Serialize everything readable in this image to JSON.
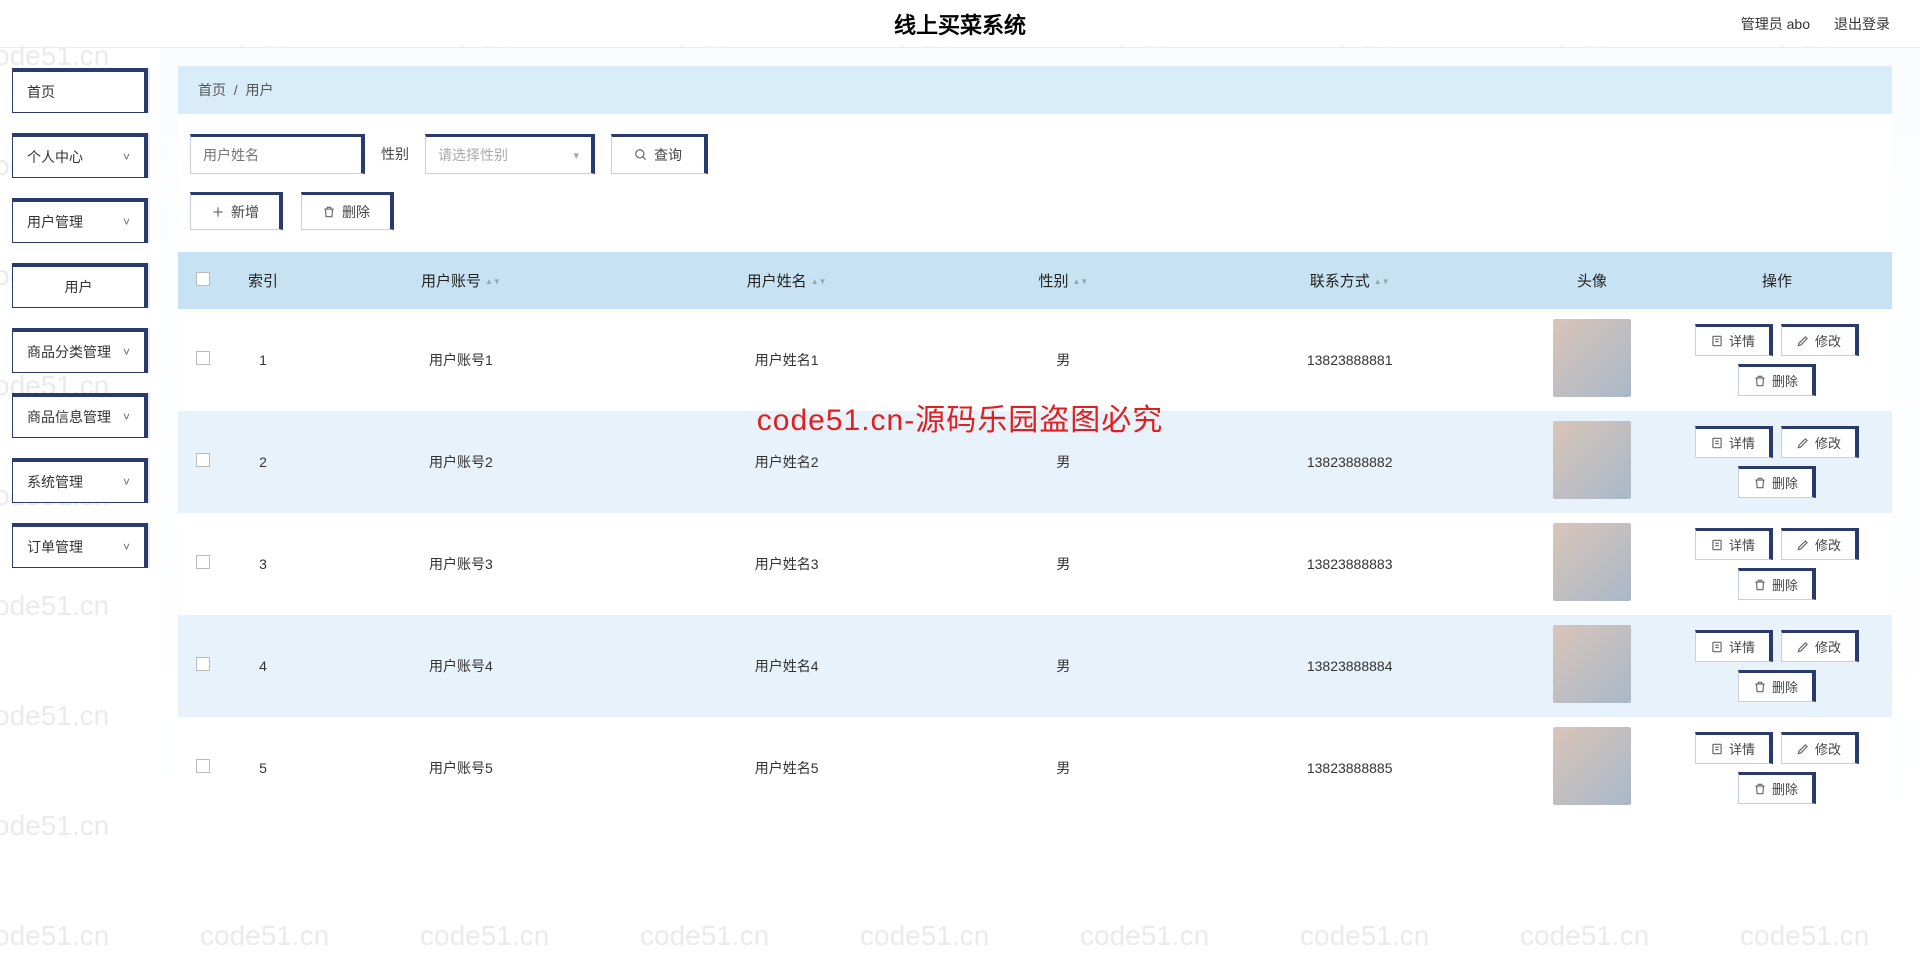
{
  "header": {
    "title": "线上买菜系统",
    "admin_label": "管理员 abo",
    "logout_label": "退出登录"
  },
  "sidebar": [
    {
      "label": "首页",
      "expandable": false
    },
    {
      "label": "个人中心",
      "expandable": true
    },
    {
      "label": "用户管理",
      "expandable": true
    },
    {
      "label": "用户",
      "expandable": false,
      "leaf": true
    },
    {
      "label": "商品分类管理",
      "expandable": true
    },
    {
      "label": "商品信息管理",
      "expandable": true
    },
    {
      "label": "系统管理",
      "expandable": true
    },
    {
      "label": "订单管理",
      "expandable": true
    }
  ],
  "breadcrumb": {
    "home": "首页",
    "sep": "/",
    "current": "用户"
  },
  "search": {
    "name_placeholder": "用户姓名",
    "gender_label": "性别",
    "gender_placeholder": "请选择性别",
    "query_btn": "查询"
  },
  "actions": {
    "add": "新增",
    "delete": "删除"
  },
  "columns": {
    "index": "索引",
    "account": "用户账号",
    "name": "用户姓名",
    "gender": "性别",
    "contact": "联系方式",
    "avatar": "头像",
    "ops": "操作"
  },
  "row_buttons": {
    "detail": "详情",
    "edit": "修改",
    "delete": "删除"
  },
  "rows": [
    {
      "index": "1",
      "account": "用户账号1",
      "name": "用户姓名1",
      "gender": "男",
      "contact": "13823888881"
    },
    {
      "index": "2",
      "account": "用户账号2",
      "name": "用户姓名2",
      "gender": "男",
      "contact": "13823888882"
    },
    {
      "index": "3",
      "account": "用户账号3",
      "name": "用户姓名3",
      "gender": "男",
      "contact": "13823888883"
    },
    {
      "index": "4",
      "account": "用户账号4",
      "name": "用户姓名4",
      "gender": "男",
      "contact": "13823888884"
    },
    {
      "index": "5",
      "account": "用户账号5",
      "name": "用户姓名5",
      "gender": "男",
      "contact": "13823888885"
    }
  ],
  "watermark_text": "code51.cn",
  "big_watermark": "code51.cn-源码乐园盗图必究"
}
